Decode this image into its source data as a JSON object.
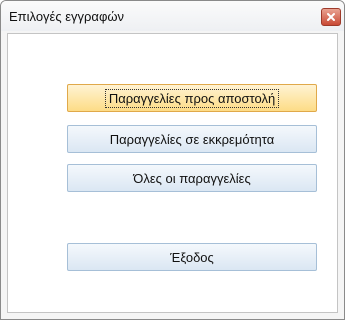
{
  "window": {
    "title": "Επιλογές εγγραφών",
    "close_icon": "close-icon"
  },
  "buttons": {
    "to_ship": "Παραγγελίες προς αποστολή",
    "pending": "Παραγγελίες σε εκκρεμότητα",
    "all": "Όλες οι παραγγελίες",
    "exit": "Έξοδος"
  },
  "colors": {
    "close_button": "#c94a35",
    "focused_button": "#fddc86",
    "button_border": "#a6bfd7"
  }
}
